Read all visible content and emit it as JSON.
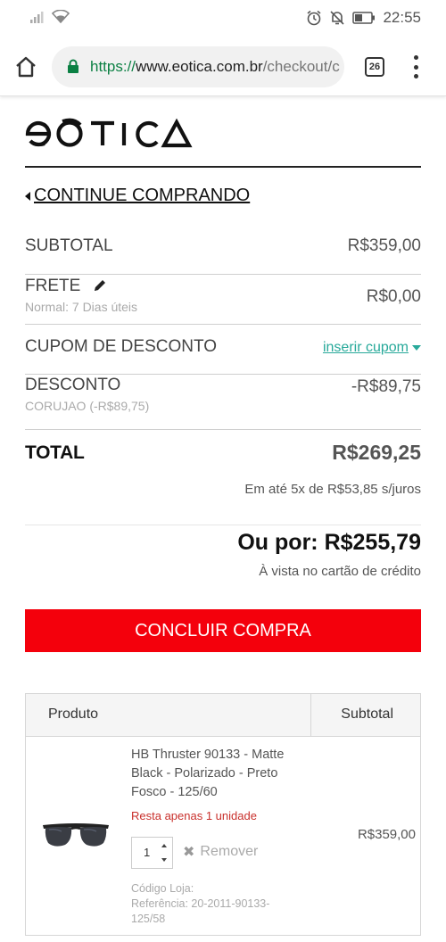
{
  "status_bar": {
    "time": "22:55",
    "icons": [
      "signal-icon",
      "wifi-icon",
      "alarm-icon",
      "notifications-off-icon",
      "battery-icon"
    ]
  },
  "browser": {
    "url_protocol": "https://",
    "url_host": "www.eotica.com.br",
    "url_path": "/checkout/c",
    "tab_count": "26"
  },
  "brand": {
    "logo_text": "EOTICA"
  },
  "nav": {
    "continue_label": "CONTINUE COMPRANDO"
  },
  "summary": {
    "subtotal_label": "SUBTOTAL",
    "subtotal_value": "R$359,00",
    "frete_label": "FRETE",
    "frete_sub": "Normal: 7 Dias úteis",
    "frete_value": "R$0,00",
    "cupom_label": "CUPOM DE DESCONTO",
    "cupom_link": "inserir cupom",
    "desconto_label": "DESCONTO",
    "desconto_sub": "CORUJAO (-R$89,75)",
    "desconto_value": "-R$89,75",
    "total_label": "TOTAL",
    "total_value": "R$269,25",
    "installments": "Em até 5x de R$53,85 s/juros",
    "oupor_label": "Ou por: R$255,79",
    "avista": "À vista no cartão de crédito"
  },
  "cta": {
    "concluir_label": "CONCLUIR COMPRA"
  },
  "colors": {
    "accent_red": "#f4000c",
    "link_teal": "#27a99a",
    "stock_red": "#c9302c"
  },
  "cart": {
    "header_produto": "Produto",
    "header_subtotal": "Subtotal",
    "items": [
      {
        "name": "HB Thruster 90133 - Matte Black - Polarizado - Preto Fosco - 125/60",
        "stock": "Resta apenas 1 unidade",
        "quantity": "1",
        "remove_label": "Remover",
        "codigo_label": "Código Loja:",
        "referencia": "Referência: 20-2011-90133-125/58",
        "subtotal": "R$359,00"
      }
    ]
  }
}
